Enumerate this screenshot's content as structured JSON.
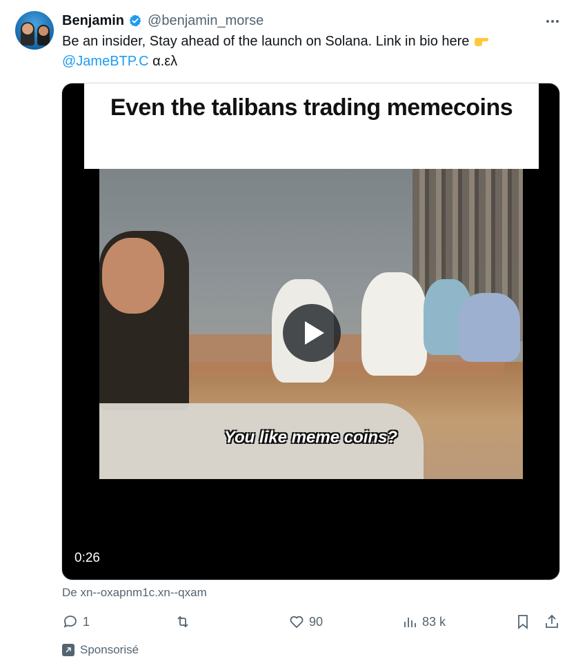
{
  "author": {
    "name": "Benjamin",
    "handle": "@benjamin_morse",
    "verified": true
  },
  "tweet": {
    "text": "Be an insider, Stay ahead of the launch on Solana. Link in bio here",
    "emoji": "pointing-right-hand-emoji",
    "mention": "@JameBTP.C",
    "suffix": " α.ελ"
  },
  "video": {
    "overlay_title": "Even the talibans trading memecoins",
    "subtitle": "You like meme coins?",
    "duration": "0:26"
  },
  "source": "De xn--oxapnm1c.xn--qxam",
  "actions": {
    "replies": "1",
    "retweets": "",
    "likes": "90",
    "views": "83 k"
  },
  "sponsored_label": "Sponsorisé",
  "colors": {
    "accent": "#1d9bf0",
    "text": "#0f1419",
    "secondary": "#536471"
  }
}
